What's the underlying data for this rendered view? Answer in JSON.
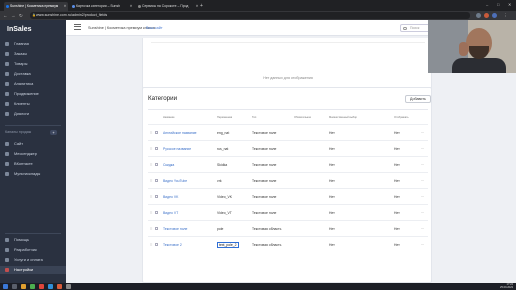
{
  "browser": {
    "tabs": [
      {
        "label": "Sunshine | Косметика премиум"
      },
      {
        "label": "Карточка категории – Sunsh"
      },
      {
        "label": "Сервисы на Сорокоте – Прод"
      }
    ],
    "url": "www.sunshine.com.ru/admin2/product_fields"
  },
  "sidebar": {
    "brand": "InSales",
    "items": [
      {
        "label": "Главная"
      },
      {
        "label": "Заказы"
      },
      {
        "label": "Товары"
      },
      {
        "label": "Доставка"
      },
      {
        "label": "Аналитика"
      },
      {
        "label": "Продвижение"
      },
      {
        "label": "Клиенты"
      },
      {
        "label": "Диалоги"
      }
    ],
    "sales_channels_label": "Каналы продаж",
    "sales_add": "+",
    "channels": [
      {
        "label": "Сайт"
      },
      {
        "label": "Мессенджер"
      },
      {
        "label": "ВКонтакте"
      },
      {
        "label": "Мультисклады"
      }
    ],
    "bottom_items": [
      {
        "label": "Помощь"
      },
      {
        "label": "Разработчик"
      },
      {
        "label": "Услуги и оплата"
      },
      {
        "label": "Настройки"
      }
    ]
  },
  "topbar": {
    "shop_name": "Sunshine | Косметика премиум класса",
    "your_site": "Ваш сайт",
    "search_placeholder": "Поиск"
  },
  "top_card": {
    "empty_message": "Нет данных для отображения"
  },
  "categories": {
    "title": "Категории",
    "add_button": "Добавить",
    "columns": {
      "name": "Название",
      "handle": "Переменная",
      "type": "Тип",
      "required": "Обязательное",
      "multiselect": "Множественный выбор",
      "show": "Отображать"
    },
    "rows": [
      {
        "name": "Английское название",
        "handle": "eng_nat",
        "type": "Текстовое поле",
        "required": "Нет",
        "show": "Нет"
      },
      {
        "name": "Русское название",
        "handle": "rus_nat",
        "type": "Текстовое поле",
        "required": "Нет",
        "show": "Нет"
      },
      {
        "name": "Скидка",
        "handle": "Skidka",
        "type": "Текстовое поле",
        "required": "Нет",
        "show": "Нет"
      },
      {
        "name": "Видео YouTube",
        "handle": "vrk",
        "type": "Текстовое поле",
        "required": "Нет",
        "show": "Нет"
      },
      {
        "name": "Видео VK",
        "handle": "Video_VK",
        "type": "Текстовое поле",
        "required": "Нет",
        "show": "Нет"
      },
      {
        "name": "Видео VT",
        "handle": "Video_VT",
        "type": "Текстовое поле",
        "required": "Нет",
        "show": "Нет"
      },
      {
        "name": "Текстовое поле",
        "handle": "pole",
        "type": "Текстовая область",
        "required": "Нет",
        "show": "Нет"
      },
      {
        "name": "Текстовое 2",
        "handle": "text_pole_2",
        "type": "Текстовая область",
        "required": "Нет",
        "show": "Нет"
      }
    ],
    "more_glyph": "···"
  },
  "taskbar": {
    "time": "17:24",
    "date": "25.09.2023"
  },
  "colors": {
    "sidebar": "#2a3140",
    "accent_link": "#3a6fc8",
    "active_icon": "#c34e4e"
  }
}
